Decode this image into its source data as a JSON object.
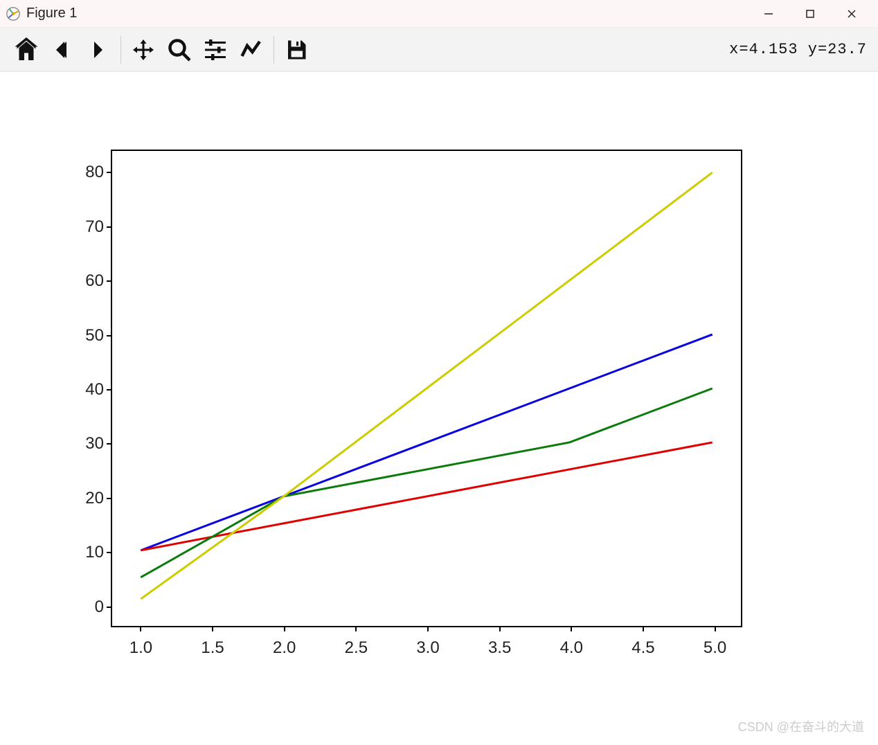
{
  "window": {
    "title": "Figure 1"
  },
  "toolbar": {
    "coords_text": "x=4.153 y=23.7"
  },
  "watermark": "CSDN @在奋斗的大道",
  "chart_data": {
    "type": "line",
    "x": [
      1,
      2,
      3,
      4,
      5
    ],
    "series": [
      {
        "name": "blue",
        "color": "#0800e0",
        "values": [
          10,
          20,
          30,
          40,
          50
        ]
      },
      {
        "name": "red",
        "color": "#e00000",
        "values": [
          10,
          15,
          20,
          25,
          30
        ]
      },
      {
        "name": "green",
        "color": "#0a7a0a",
        "values": [
          5,
          20,
          25,
          30,
          40
        ]
      },
      {
        "name": "yellow",
        "color": "#cccc00",
        "values": [
          1,
          20,
          40,
          60,
          80
        ]
      }
    ],
    "xlim": [
      0.8,
      5.2
    ],
    "ylim": [
      -4,
      84
    ],
    "xticks": [
      1.0,
      1.5,
      2.0,
      2.5,
      3.0,
      3.5,
      4.0,
      4.5,
      5.0
    ],
    "yticks": [
      0,
      10,
      20,
      30,
      40,
      50,
      60,
      70,
      80
    ],
    "xtick_labels": [
      "1.0",
      "1.5",
      "2.0",
      "2.5",
      "3.0",
      "3.5",
      "4.0",
      "4.5",
      "5.0"
    ],
    "ytick_labels": [
      "0",
      "10",
      "20",
      "30",
      "40",
      "50",
      "60",
      "70",
      "80"
    ],
    "title": "",
    "xlabel": "",
    "ylabel": ""
  }
}
